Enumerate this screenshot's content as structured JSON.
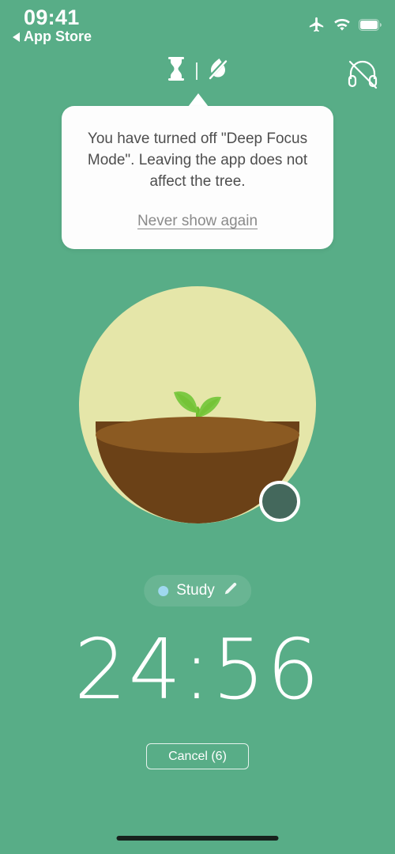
{
  "status_bar": {
    "time": "09:41",
    "back_label": "App Store",
    "back_icon": "back-triangle-icon",
    "icons": [
      "airplane-mode-icon",
      "wifi-icon",
      "battery-icon"
    ]
  },
  "focus_bar": {
    "timer_mode_icon": "hourglass-icon",
    "deep_focus_icon": "deep-focus-off-icon",
    "sound_icon": "headphones-muted-icon"
  },
  "tooltip": {
    "message": "You have turned off \"Deep Focus Mode\". Leaving the app does not affect the tree.",
    "link_label": "Never show again"
  },
  "scene": {
    "plant_stage_name": "sapling",
    "circle_color": "#E5E6A9",
    "soil_top_color": "#8B5A22",
    "soil_body_color": "#6B4117",
    "leaf_color": "#7DC943",
    "stem_color": "#6FBE2E",
    "badge_icon": "tree-species-badge",
    "badge_color": "#44685C"
  },
  "tag": {
    "label": "Study",
    "dot_color": "#9FD8EF",
    "edit_icon": "pencil-icon"
  },
  "timer": {
    "remaining": "24:56"
  },
  "actions": {
    "cancel_label": "Cancel (6)"
  },
  "colors": {
    "background": "#58AD87",
    "accent_white": "#FFFFFF",
    "tooltip_background": "#FDFDFD",
    "tooltip_text": "#4E4E4E"
  }
}
